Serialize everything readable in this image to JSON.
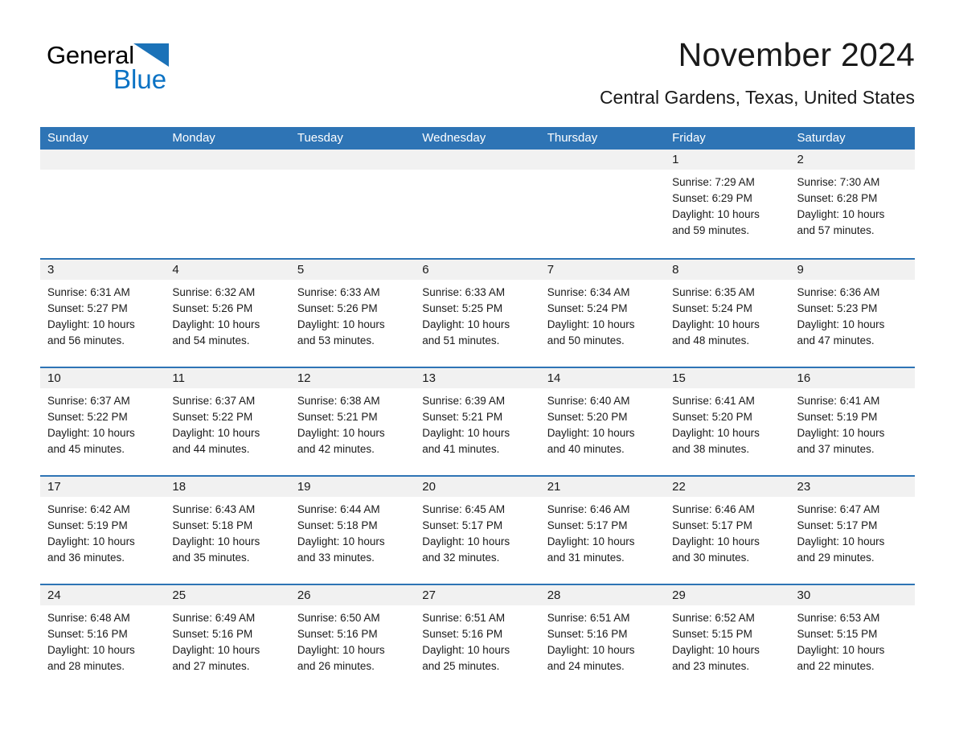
{
  "brand": {
    "name_part1": "General",
    "name_part2": "Blue",
    "triangle_color": "#1b72b8",
    "blue_color": "#0a72c4"
  },
  "header": {
    "title": "November 2024",
    "subtitle": "Central Gardens, Texas, United States"
  },
  "theme": {
    "header_blue": "#2e74b5",
    "day_band_gray": "#f1f1f1",
    "text_color": "#1a1a1a"
  },
  "weekdays": [
    "Sunday",
    "Monday",
    "Tuesday",
    "Wednesday",
    "Thursday",
    "Friday",
    "Saturday"
  ],
  "weeks": [
    [
      {
        "day": "",
        "empty": true
      },
      {
        "day": "",
        "empty": true
      },
      {
        "day": "",
        "empty": true
      },
      {
        "day": "",
        "empty": true
      },
      {
        "day": "",
        "empty": true
      },
      {
        "day": "1",
        "sunrise": "Sunrise: 7:29 AM",
        "sunset": "Sunset: 6:29 PM",
        "daylight_line1": "Daylight: 10 hours",
        "daylight_line2": "and 59 minutes."
      },
      {
        "day": "2",
        "sunrise": "Sunrise: 7:30 AM",
        "sunset": "Sunset: 6:28 PM",
        "daylight_line1": "Daylight: 10 hours",
        "daylight_line2": "and 57 minutes."
      }
    ],
    [
      {
        "day": "3",
        "sunrise": "Sunrise: 6:31 AM",
        "sunset": "Sunset: 5:27 PM",
        "daylight_line1": "Daylight: 10 hours",
        "daylight_line2": "and 56 minutes."
      },
      {
        "day": "4",
        "sunrise": "Sunrise: 6:32 AM",
        "sunset": "Sunset: 5:26 PM",
        "daylight_line1": "Daylight: 10 hours",
        "daylight_line2": "and 54 minutes."
      },
      {
        "day": "5",
        "sunrise": "Sunrise: 6:33 AM",
        "sunset": "Sunset: 5:26 PM",
        "daylight_line1": "Daylight: 10 hours",
        "daylight_line2": "and 53 minutes."
      },
      {
        "day": "6",
        "sunrise": "Sunrise: 6:33 AM",
        "sunset": "Sunset: 5:25 PM",
        "daylight_line1": "Daylight: 10 hours",
        "daylight_line2": "and 51 minutes."
      },
      {
        "day": "7",
        "sunrise": "Sunrise: 6:34 AM",
        "sunset": "Sunset: 5:24 PM",
        "daylight_line1": "Daylight: 10 hours",
        "daylight_line2": "and 50 minutes."
      },
      {
        "day": "8",
        "sunrise": "Sunrise: 6:35 AM",
        "sunset": "Sunset: 5:24 PM",
        "daylight_line1": "Daylight: 10 hours",
        "daylight_line2": "and 48 minutes."
      },
      {
        "day": "9",
        "sunrise": "Sunrise: 6:36 AM",
        "sunset": "Sunset: 5:23 PM",
        "daylight_line1": "Daylight: 10 hours",
        "daylight_line2": "and 47 minutes."
      }
    ],
    [
      {
        "day": "10",
        "sunrise": "Sunrise: 6:37 AM",
        "sunset": "Sunset: 5:22 PM",
        "daylight_line1": "Daylight: 10 hours",
        "daylight_line2": "and 45 minutes."
      },
      {
        "day": "11",
        "sunrise": "Sunrise: 6:37 AM",
        "sunset": "Sunset: 5:22 PM",
        "daylight_line1": "Daylight: 10 hours",
        "daylight_line2": "and 44 minutes."
      },
      {
        "day": "12",
        "sunrise": "Sunrise: 6:38 AM",
        "sunset": "Sunset: 5:21 PM",
        "daylight_line1": "Daylight: 10 hours",
        "daylight_line2": "and 42 minutes."
      },
      {
        "day": "13",
        "sunrise": "Sunrise: 6:39 AM",
        "sunset": "Sunset: 5:21 PM",
        "daylight_line1": "Daylight: 10 hours",
        "daylight_line2": "and 41 minutes."
      },
      {
        "day": "14",
        "sunrise": "Sunrise: 6:40 AM",
        "sunset": "Sunset: 5:20 PM",
        "daylight_line1": "Daylight: 10 hours",
        "daylight_line2": "and 40 minutes."
      },
      {
        "day": "15",
        "sunrise": "Sunrise: 6:41 AM",
        "sunset": "Sunset: 5:20 PM",
        "daylight_line1": "Daylight: 10 hours",
        "daylight_line2": "and 38 minutes."
      },
      {
        "day": "16",
        "sunrise": "Sunrise: 6:41 AM",
        "sunset": "Sunset: 5:19 PM",
        "daylight_line1": "Daylight: 10 hours",
        "daylight_line2": "and 37 minutes."
      }
    ],
    [
      {
        "day": "17",
        "sunrise": "Sunrise: 6:42 AM",
        "sunset": "Sunset: 5:19 PM",
        "daylight_line1": "Daylight: 10 hours",
        "daylight_line2": "and 36 minutes."
      },
      {
        "day": "18",
        "sunrise": "Sunrise: 6:43 AM",
        "sunset": "Sunset: 5:18 PM",
        "daylight_line1": "Daylight: 10 hours",
        "daylight_line2": "and 35 minutes."
      },
      {
        "day": "19",
        "sunrise": "Sunrise: 6:44 AM",
        "sunset": "Sunset: 5:18 PM",
        "daylight_line1": "Daylight: 10 hours",
        "daylight_line2": "and 33 minutes."
      },
      {
        "day": "20",
        "sunrise": "Sunrise: 6:45 AM",
        "sunset": "Sunset: 5:17 PM",
        "daylight_line1": "Daylight: 10 hours",
        "daylight_line2": "and 32 minutes."
      },
      {
        "day": "21",
        "sunrise": "Sunrise: 6:46 AM",
        "sunset": "Sunset: 5:17 PM",
        "daylight_line1": "Daylight: 10 hours",
        "daylight_line2": "and 31 minutes."
      },
      {
        "day": "22",
        "sunrise": "Sunrise: 6:46 AM",
        "sunset": "Sunset: 5:17 PM",
        "daylight_line1": "Daylight: 10 hours",
        "daylight_line2": "and 30 minutes."
      },
      {
        "day": "23",
        "sunrise": "Sunrise: 6:47 AM",
        "sunset": "Sunset: 5:17 PM",
        "daylight_line1": "Daylight: 10 hours",
        "daylight_line2": "and 29 minutes."
      }
    ],
    [
      {
        "day": "24",
        "sunrise": "Sunrise: 6:48 AM",
        "sunset": "Sunset: 5:16 PM",
        "daylight_line1": "Daylight: 10 hours",
        "daylight_line2": "and 28 minutes."
      },
      {
        "day": "25",
        "sunrise": "Sunrise: 6:49 AM",
        "sunset": "Sunset: 5:16 PM",
        "daylight_line1": "Daylight: 10 hours",
        "daylight_line2": "and 27 minutes."
      },
      {
        "day": "26",
        "sunrise": "Sunrise: 6:50 AM",
        "sunset": "Sunset: 5:16 PM",
        "daylight_line1": "Daylight: 10 hours",
        "daylight_line2": "and 26 minutes."
      },
      {
        "day": "27",
        "sunrise": "Sunrise: 6:51 AM",
        "sunset": "Sunset: 5:16 PM",
        "daylight_line1": "Daylight: 10 hours",
        "daylight_line2": "and 25 minutes."
      },
      {
        "day": "28",
        "sunrise": "Sunrise: 6:51 AM",
        "sunset": "Sunset: 5:16 PM",
        "daylight_line1": "Daylight: 10 hours",
        "daylight_line2": "and 24 minutes."
      },
      {
        "day": "29",
        "sunrise": "Sunrise: 6:52 AM",
        "sunset": "Sunset: 5:15 PM",
        "daylight_line1": "Daylight: 10 hours",
        "daylight_line2": "and 23 minutes."
      },
      {
        "day": "30",
        "sunrise": "Sunrise: 6:53 AM",
        "sunset": "Sunset: 5:15 PM",
        "daylight_line1": "Daylight: 10 hours",
        "daylight_line2": "and 22 minutes."
      }
    ]
  ]
}
